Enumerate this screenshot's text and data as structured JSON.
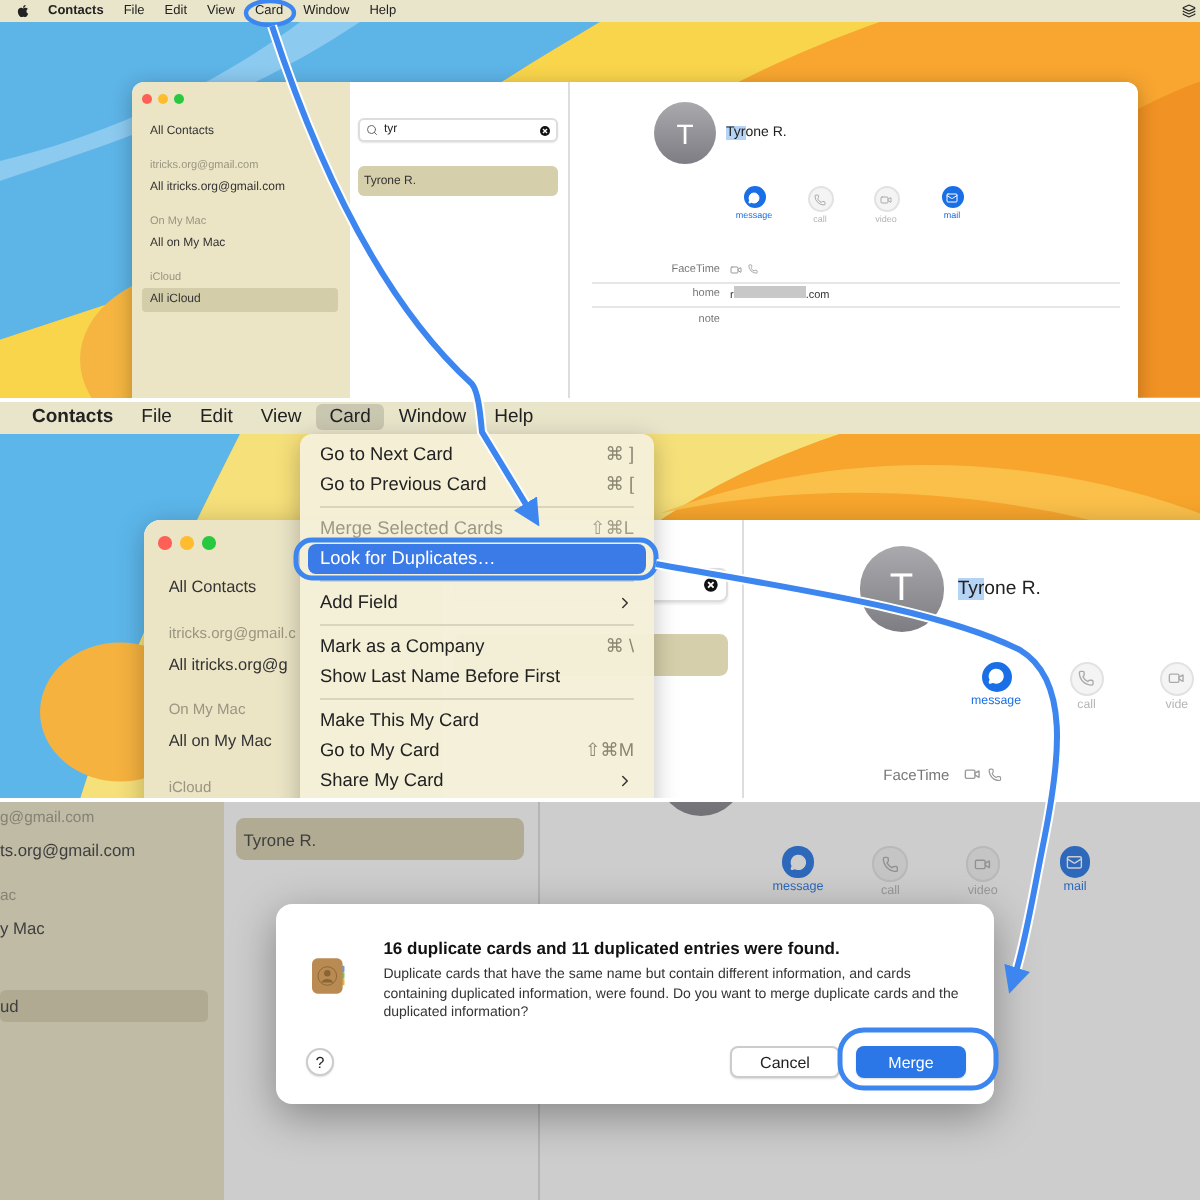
{
  "step1": {
    "menu_bar": {
      "app": "Contacts",
      "items": [
        {
          "label": "File",
          "selected": false
        },
        {
          "label": "Edit",
          "selected": false
        },
        {
          "label": "View",
          "selected": false
        },
        {
          "label": "Card",
          "selected": false
        },
        {
          "label": "Window",
          "selected": false
        },
        {
          "label": "Help",
          "selected": false
        }
      ]
    },
    "window": {
      "window_controls": true,
      "sidebar": [
        {
          "items": [
            {
              "label": "All Contacts",
              "selected": false
            }
          ]
        },
        {
          "header": "itricks.org@gmail.com",
          "items": [
            {
              "label": "All itricks.org@gmail.com",
              "selected": false
            }
          ]
        },
        {
          "header": "On My Mac",
          "items": [
            {
              "label": "All on My Mac",
              "selected": false
            }
          ]
        },
        {
          "header": "iCloud",
          "items": [
            {
              "label": "All iCloud",
              "selected": true
            }
          ]
        }
      ],
      "search": {
        "value": "tyr",
        "clear_button": true
      },
      "list": [
        {
          "name": "Tyrone R.",
          "selected": true
        }
      ],
      "contact": {
        "initial": "T",
        "name_match": "Tyr",
        "name_rest": "one R.",
        "actions": [
          {
            "kind": "message",
            "label": "message",
            "enabled": true
          },
          {
            "kind": "call",
            "label": "call",
            "enabled": false
          },
          {
            "kind": "video",
            "label": "video",
            "enabled": false
          },
          {
            "kind": "mail",
            "label": "mail",
            "enabled": true
          }
        ],
        "fields": [
          {
            "kind": "facetime",
            "label": "FaceTime"
          },
          {
            "kind": "text",
            "label": "home",
            "value_start": "r",
            "value_end": ".com",
            "redacted": true
          },
          {
            "kind": "text",
            "label": "note"
          }
        ]
      }
    }
  },
  "step2": {
    "menu_bar": {
      "app": "Contacts",
      "items": [
        {
          "label": "File",
          "selected": false
        },
        {
          "label": "Edit",
          "selected": false
        },
        {
          "label": "View",
          "selected": false
        },
        {
          "label": "Card",
          "selected": true
        },
        {
          "label": "Window",
          "selected": false
        },
        {
          "label": "Help",
          "selected": false
        }
      ]
    },
    "menu": [
      {
        "kind": "item",
        "label": "Go to Next Card",
        "shortcut": "⌘ ]",
        "disabled": false,
        "selected": false
      },
      {
        "kind": "item",
        "label": "Go to Previous Card",
        "shortcut": "⌘ [",
        "disabled": false,
        "selected": false
      },
      {
        "kind": "separator"
      },
      {
        "kind": "item",
        "label": "Merge Selected Cards",
        "shortcut": "⇧⌘L",
        "disabled": true,
        "selected": false
      },
      {
        "kind": "item",
        "label": "Look for Duplicates…",
        "disabled": false,
        "selected": true
      },
      {
        "kind": "separator"
      },
      {
        "kind": "item",
        "label": "Add Field",
        "submenu": true,
        "disabled": false,
        "selected": false
      },
      {
        "kind": "separator"
      },
      {
        "kind": "item",
        "label": "Mark as a Company",
        "shortcut": "⌘ \\",
        "disabled": false,
        "selected": false
      },
      {
        "kind": "item",
        "label": "Show Last Name Before First",
        "disabled": false,
        "selected": false
      },
      {
        "kind": "separator"
      },
      {
        "kind": "item",
        "label": "Make This My Card",
        "disabled": false,
        "selected": false
      },
      {
        "kind": "item",
        "label": "Go to My Card",
        "shortcut": "⇧⌘M",
        "disabled": false,
        "selected": false
      },
      {
        "kind": "item",
        "label": "Share My Card",
        "submenu": true,
        "disabled": false,
        "selected": false
      }
    ],
    "window": {
      "window_controls": true,
      "sidebar": [
        {
          "items": [
            {
              "label": "All Contacts",
              "selected": false
            }
          ]
        },
        {
          "header": "itricks.org@gmail.c",
          "items": [
            {
              "label": "All itricks.org@g",
              "selected": false
            }
          ]
        },
        {
          "header": "On My Mac",
          "items": [
            {
              "label": "All on My Mac",
              "selected": false
            }
          ]
        },
        {
          "header": "iCloud"
        }
      ],
      "search": {
        "clear_button": true
      },
      "list": [
        {
          "selected": true
        }
      ],
      "contact": {
        "initial": "T",
        "name_match": "Tyr",
        "name_rest": "one R.",
        "actions": [
          {
            "kind": "message",
            "label": "message",
            "enabled": true
          },
          {
            "kind": "call",
            "label": "call",
            "enabled": false
          },
          {
            "kind": "video",
            "label": "vide",
            "enabled": false
          }
        ],
        "fields": [
          {
            "kind": "facetime",
            "label": "FaceTime"
          }
        ]
      }
    }
  },
  "step3": {
    "window": {
      "sidebar": [
        {
          "header": "g@gmail.com",
          "items": [
            {
              "label": "ts.org@gmail.com",
              "selected": false
            }
          ]
        },
        {
          "header": "ac",
          "items": [
            {
              "label": "y Mac",
              "selected": false
            }
          ]
        },
        {
          "items": [
            {
              "label": "ud",
              "selected": true
            }
          ]
        }
      ],
      "list": [
        {
          "name": "Tyrone R.",
          "selected": true
        }
      ],
      "contact": {
        "avatar": true,
        "actions": [
          {
            "kind": "message",
            "label": "message",
            "enabled": true
          },
          {
            "kind": "call",
            "label": "call",
            "enabled": false
          },
          {
            "kind": "video",
            "label": "video",
            "enabled": false
          },
          {
            "kind": "mail",
            "label": "mail",
            "enabled": true
          }
        ]
      }
    },
    "dialog": {
      "title": "16 duplicate cards and 11 duplicated entries were found.",
      "message": "Duplicate cards that have the same name but contain different information, and cards containing duplicated information, were found. Do you want to merge duplicate cards and the duplicated information?",
      "help": "?",
      "buttons": [
        {
          "label": "Cancel",
          "default": false
        },
        {
          "label": "Merge",
          "default": true
        }
      ]
    }
  }
}
